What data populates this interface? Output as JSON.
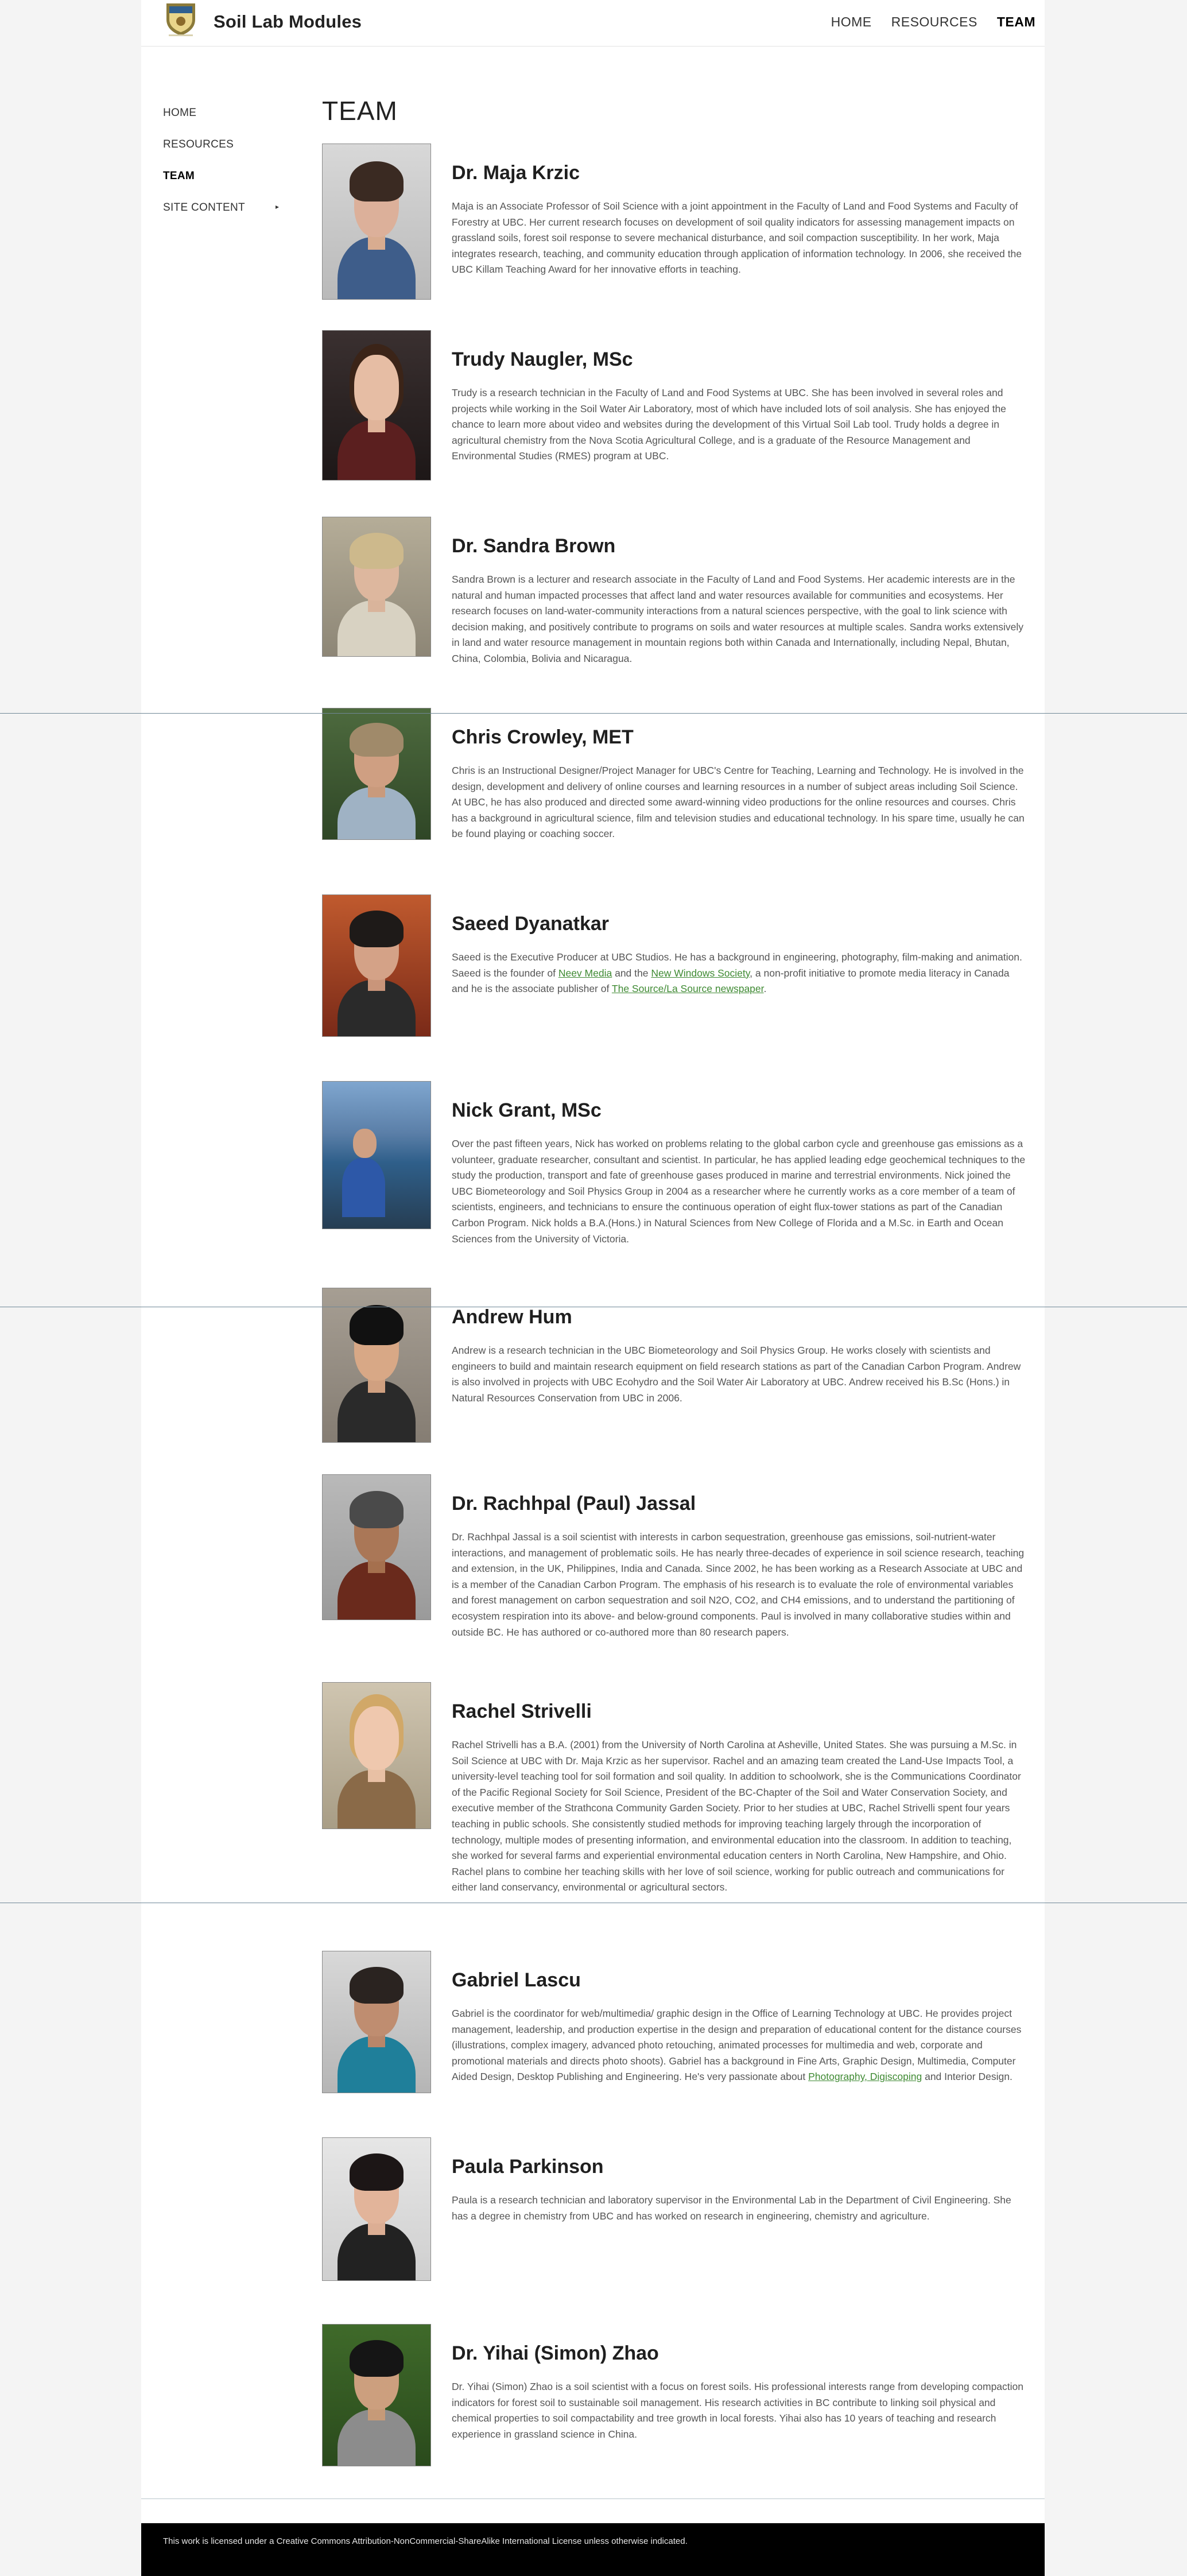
{
  "header": {
    "site_title": "Soil Lab Modules",
    "logo_icon": "ubc-crest-icon",
    "nav": [
      {
        "label": "HOME",
        "active": false
      },
      {
        "label": "RESOURCES",
        "active": false
      },
      {
        "label": "TEAM",
        "active": true
      }
    ]
  },
  "sidenav": {
    "items": [
      {
        "label": "HOME",
        "active": false
      },
      {
        "label": "RESOURCES",
        "active": false
      },
      {
        "label": "TEAM",
        "active": true
      },
      {
        "label": "SITE CONTENT",
        "active": false,
        "has_submenu": true,
        "caret": "▸"
      }
    ]
  },
  "main": {
    "heading": "TEAM",
    "members": [
      {
        "name": "Dr. Maja Krzic",
        "bio": "Maja is an Associate Professor of Soil Science with a joint appointment in the Faculty of Land and Food Systems and Faculty of Forestry at UBC. Her current research focuses on development of soil quality indicators for assessing management impacts on grassland soils, forest soil response to severe mechanical disturbance, and soil compaction susceptibility. In her work, Maja integrates research, teaching, and community education through application of information technology. In 2006, she received the UBC Killam Teaching Award for her innovative efforts in teaching."
      },
      {
        "name": "Trudy Naugler, MSc",
        "bio": "Trudy is a research technician in the Faculty of Land and Food Systems at UBC. She has been involved in several roles and projects while working in the Soil Water Air Laboratory, most of which have included lots of soil analysis. She has enjoyed the chance to learn more about video and websites during the development of this Virtual Soil Lab tool. Trudy holds a degree in agricultural chemistry from the Nova Scotia Agricultural College, and is a graduate of the Resource Management and Environmental Studies (RMES) program at UBC."
      },
      {
        "name": "Dr. Sandra Brown",
        "bio": "Sandra Brown is a lecturer and research associate in the Faculty of Land and Food Systems. Her academic interests are in the natural and human impacted processes that affect land and water resources available for communities and ecosystems. Her research focuses on land-water-community interactions from a natural sciences perspective, with the goal to link science with decision making, and positively contribute to programs on soils and water resources at multiple scales. Sandra works extensively in land and water resource management in mountain regions both within Canada and Internationally, including Nepal, Bhutan, China, Colombia, Bolivia and Nicaragua."
      },
      {
        "name": "Chris Crowley, MET",
        "bio": "Chris is an Instructional Designer/Project Manager for UBC's Centre for Teaching, Learning and Technology. He is involved in the design, development and delivery of online courses and learning resources in a number of subject areas including Soil Science. At UBC, he has also produced and directed some award-winning video productions for the online resources and courses. Chris has a background in agricultural science, film and television studies and educational technology. In his spare time, usually he can be found playing or coaching soccer."
      },
      {
        "name": "Saeed Dyanatkar",
        "bio_parts": [
          "Saeed is the Executive Producer at UBC Studios. He has a background in engineering, photography, film-making and animation. Saeed is the founder of ",
          "Neev Media",
          " and the ",
          "New Windows Society",
          ", a non-profit initiative to promote media literacy in Canada and he is the associate publisher of ",
          "The Source/La Source newspaper",
          "."
        ]
      },
      {
        "name": "Nick Grant, MSc",
        "bio": "Over the past fifteen years, Nick has worked on problems relating to the global carbon cycle and greenhouse gas emissions as a volunteer, graduate researcher, consultant and scientist. In particular, he has applied leading edge geochemical techniques to the study the production, transport and fate of greenhouse gases produced in marine and terrestrial environments. Nick joined the UBC Biometeorology and Soil Physics Group in 2004 as a researcher where he currently works as a core member of a team of scientists, engineers, and technicians to ensure the continuous operation of eight flux-tower stations as part of the Canadian Carbon Program. Nick holds a B.A.(Hons.) in Natural Sciences from New College of Florida and a M.Sc. in Earth and Ocean Sciences from the University of Victoria."
      },
      {
        "name": "Andrew Hum",
        "bio": "Andrew is a research technician in the UBC Biometeorology and Soil Physics Group. He works closely with scientists and engineers to build and maintain research equipment on field research stations as part of the Canadian Carbon Program. Andrew is also involved in projects with UBC Ecohydro and the Soil Water Air Laboratory at UBC. Andrew received his B.Sc (Hons.) in Natural Resources Conservation from UBC in 2006."
      },
      {
        "name": "Dr. Rachhpal (Paul) Jassal",
        "bio": "Dr. Rachhpal Jassal is a soil scientist with interests in carbon sequestration, greenhouse gas emissions, soil-nutrient-water interactions, and management of problematic soils. He has nearly three-decades of experience in soil science research, teaching and extension, in the UK, Philippines, India and Canada. Since 2002, he has been working as a Research Associate at UBC and is a member of the Canadian Carbon Program. The emphasis of his research is to evaluate the role of environmental variables and forest management on carbon sequestration and soil N2O, CO2, and CH4 emissions, and to understand the partitioning of ecosystem respiration into its above- and below-ground components. Paul is involved in many collaborative studies within and outside BC. He has authored or co-authored more than 80 research papers."
      },
      {
        "name": "Rachel Strivelli",
        "bio": "Rachel Strivelli has a B.A. (2001) from the University of North Carolina at Asheville, United States. She was pursuing a M.Sc. in Soil Science at UBC with Dr. Maja Krzic as her supervisor. Rachel and an amazing team created the Land-Use Impacts Tool, a university-level teaching tool for soil formation and soil quality. In addition to schoolwork, she is the Communications Coordinator of the Pacific Regional Society for Soil Science, President of the BC-Chapter of the Soil and Water Conservation Society, and executive member of the Strathcona Community Garden Society. Prior to her studies at UBC, Rachel Strivelli spent four years teaching in public schools. She consistently studied methods for improving teaching largely through the incorporation of technology, multiple modes of presenting information, and environmental education into the classroom. In addition to teaching, she worked for several farms and experiential environmental education centers in North Carolina, New Hampshire, and Ohio. Rachel plans to combine her teaching skills with her love of soil science, working for public outreach and communications for either land conservancy, environmental or agricultural sectors."
      },
      {
        "name": "Gabriel Lascu",
        "bio_parts": [
          "Gabriel is the coordinator for web/multimedia/ graphic design in the Office of Learning Technology at UBC. He provides project management, leadership, and production expertise in the design and preparation of educational content for the distance courses (illustrations, complex imagery, advanced photo retouching, animated processes for multimedia and web, corporate and promotional materials and directs photo shoots). Gabriel has a background in Fine Arts, Graphic Design, Multimedia, Computer Aided Design, Desktop Publishing and Engineering. He's very passionate about ",
          "Photography, Digiscoping",
          " and Interior Design."
        ]
      },
      {
        "name": "Paula Parkinson",
        "bio": "Paula is a research technician and laboratory supervisor in the Environmental Lab in the Department of Civil Engineering. She has a degree in chemistry from UBC and has worked on research in engineering, chemistry and agriculture."
      },
      {
        "name": "Dr. Yihai (Simon) Zhao",
        "bio": "Dr. Yihai (Simon) Zhao is a soil scientist with a focus on forest soils. His professional interests range from developing compaction indicators for forest soil to sustainable soil management. His research activities in BC contribute to linking soil physical and chemical properties to soil compactability and tree growth in local forests. Yihai also has 10 years of teaching and research experience in grassland science in China."
      }
    ]
  },
  "footer": {
    "license_text": "This work is licensed under a Creative Commons Attribution-NonCommercial-ShareAlike International License unless otherwise indicated."
  },
  "colors": {
    "link": "#3f8a33",
    "footer_bg": "#000000",
    "page_bg": "#f4f4f4",
    "content_bg": "#ffffff"
  }
}
